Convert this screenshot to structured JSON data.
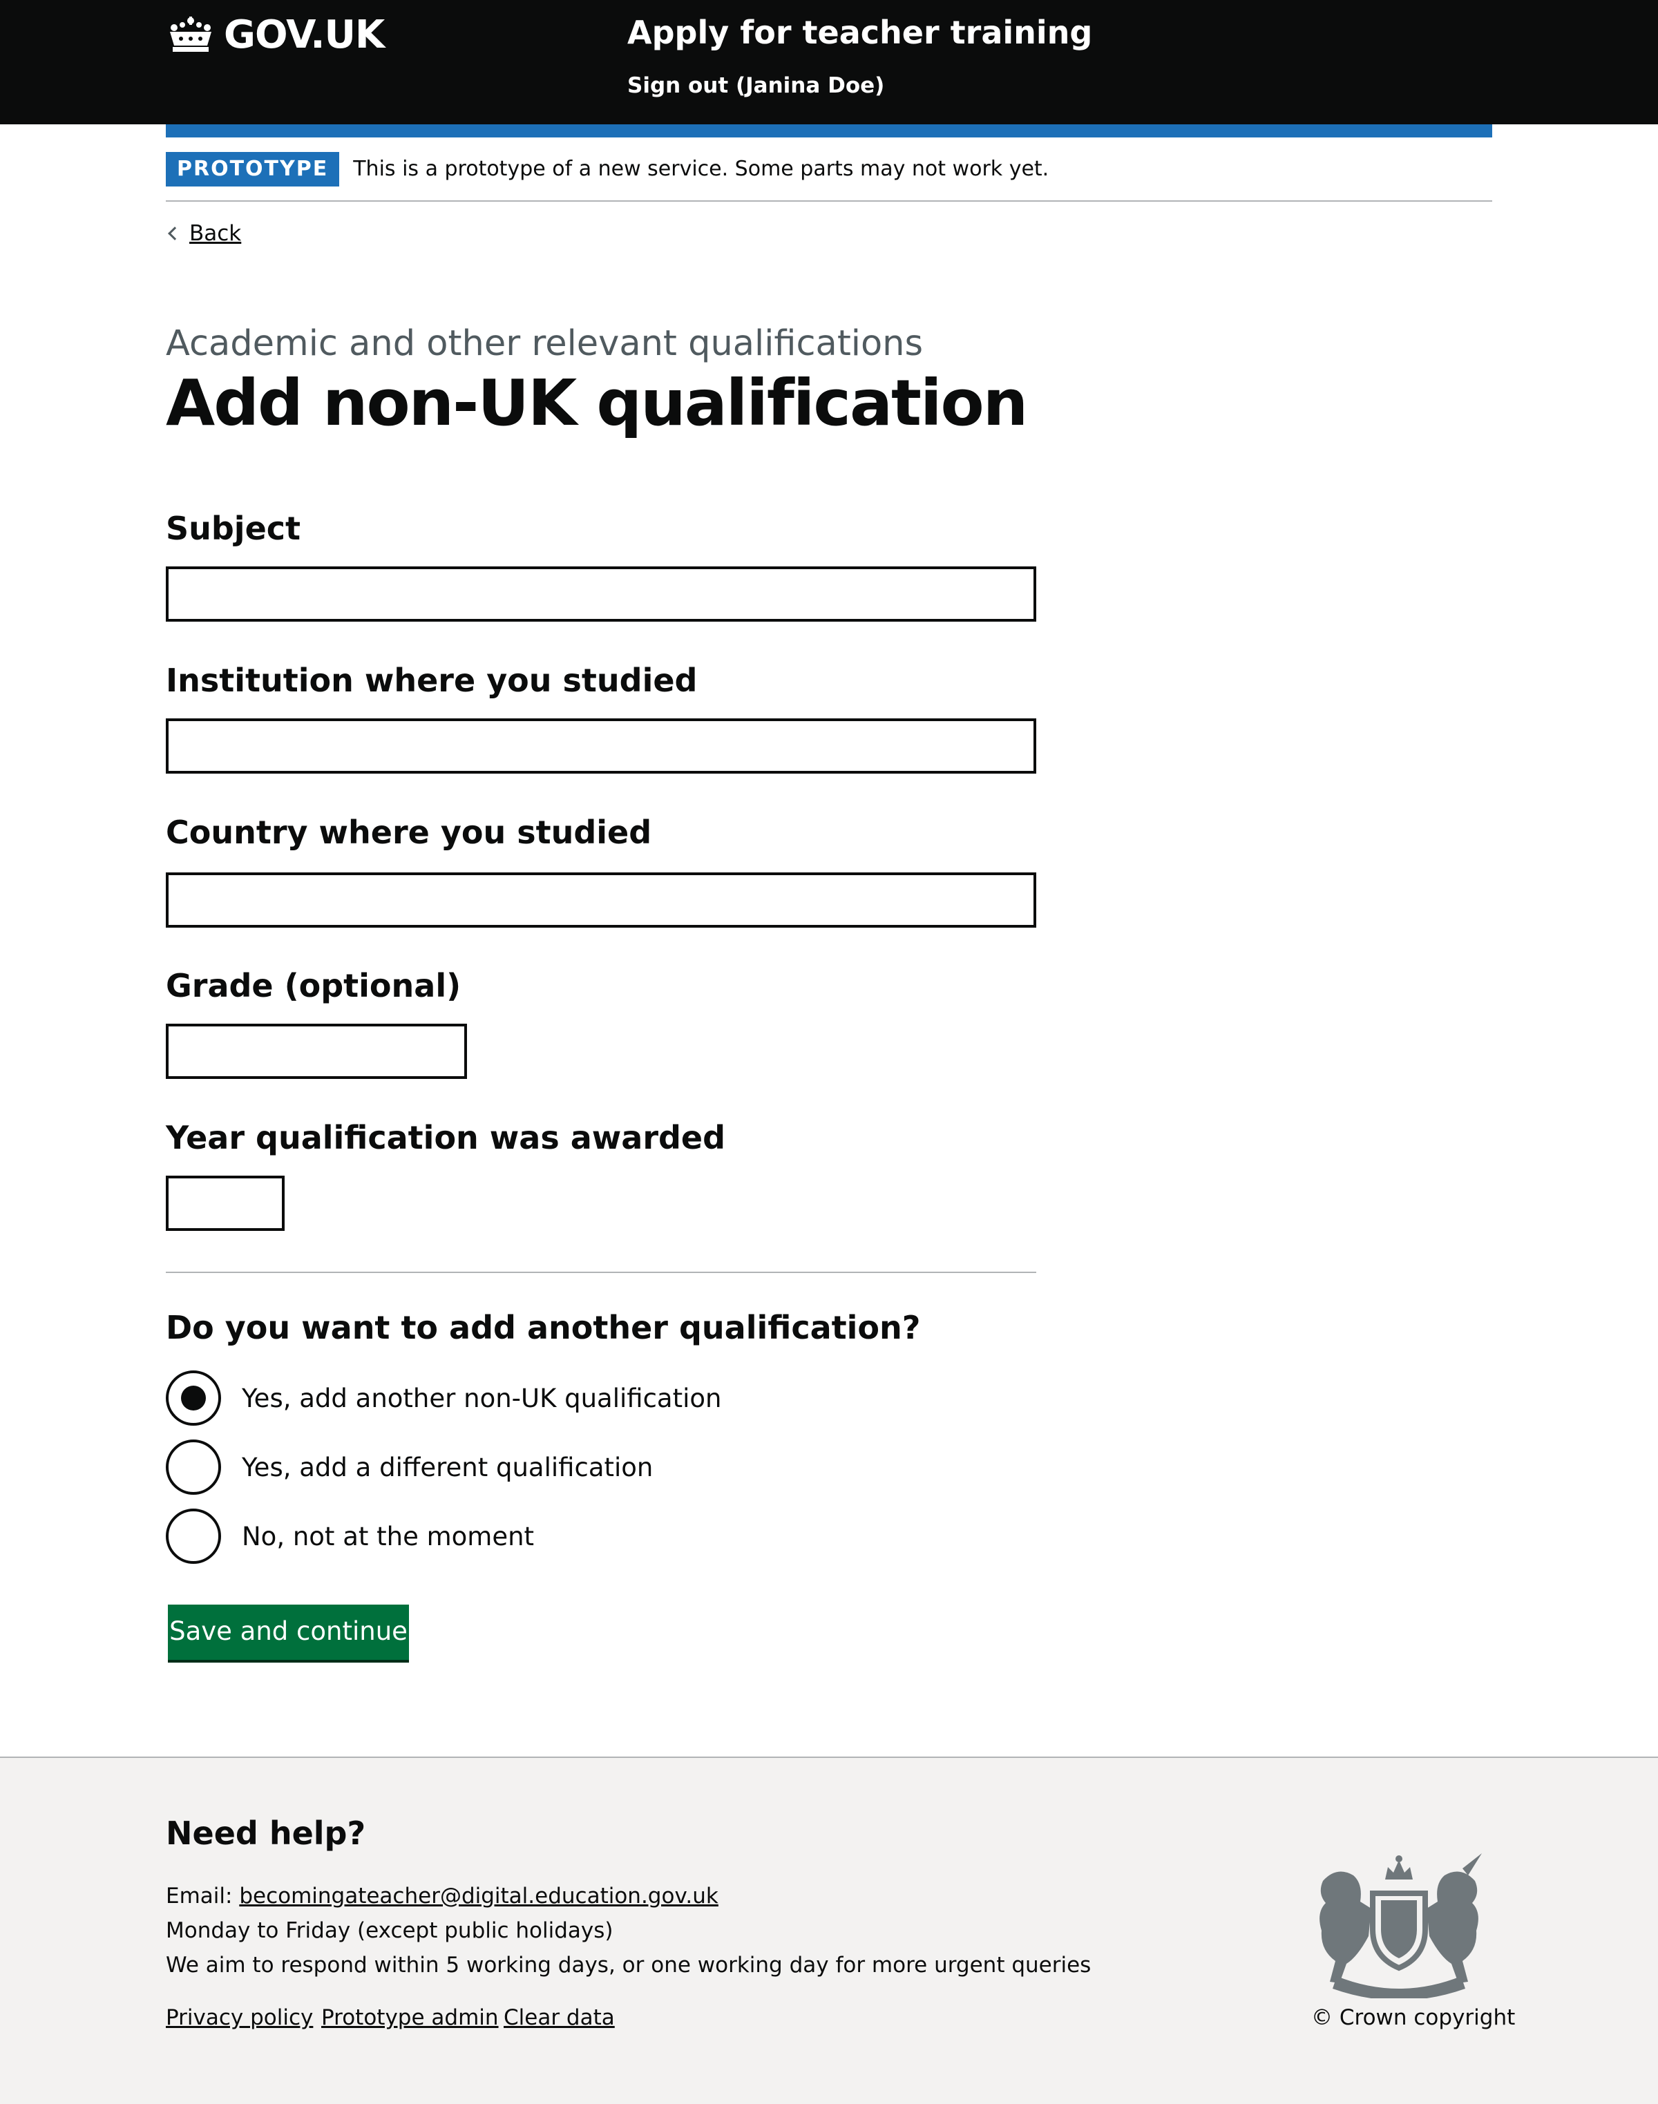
{
  "header": {
    "logo_text": "GOV.UK",
    "logo_icon": "crown-icon",
    "service_name": "Apply for teacher training",
    "sign_out": "Sign out (Janina Doe)"
  },
  "phase_banner": {
    "tag": "PROTOTYPE",
    "text": "This is a prototype of a new service. Some parts may not work yet."
  },
  "back_link": "Back",
  "page": {
    "caption": "Academic and other relevant qualifications",
    "title": "Add non-UK qualification"
  },
  "form": {
    "fields": [
      {
        "label": "Subject",
        "value": ""
      },
      {
        "label": "Institution where you studied",
        "value": ""
      },
      {
        "label": "Country where you studied",
        "value": ""
      },
      {
        "label": "Grade (optional)",
        "value": ""
      },
      {
        "label": "Year qualification was awarded",
        "value": ""
      }
    ],
    "question": "Do you want to add another qualification?",
    "options": [
      {
        "label": "Yes, add another non-UK qualification",
        "checked": true
      },
      {
        "label": "Yes, add a different qualification",
        "checked": false
      },
      {
        "label": "No, not at the moment",
        "checked": false
      }
    ],
    "submit_label": "Save and continue"
  },
  "footer": {
    "help_heading": "Need help?",
    "email_prefix": "Email: ",
    "email": "becomingateacher@digital.education.gov.uk",
    "hours": "Monday to Friday (except public holidays)",
    "response": "We aim to respond within 5 working days, or one working day for more urgent queries",
    "links": [
      "Privacy policy",
      "Prototype admin",
      "Clear data"
    ],
    "crest_icon": "royal-coat-of-arms-icon",
    "copyright": "© Crown copyright"
  },
  "colors": {
    "header_bg": "#0b0c0c",
    "brand_blue": "#1d70b8",
    "button_green": "#00703c",
    "footer_bg": "#f3f2f1"
  }
}
